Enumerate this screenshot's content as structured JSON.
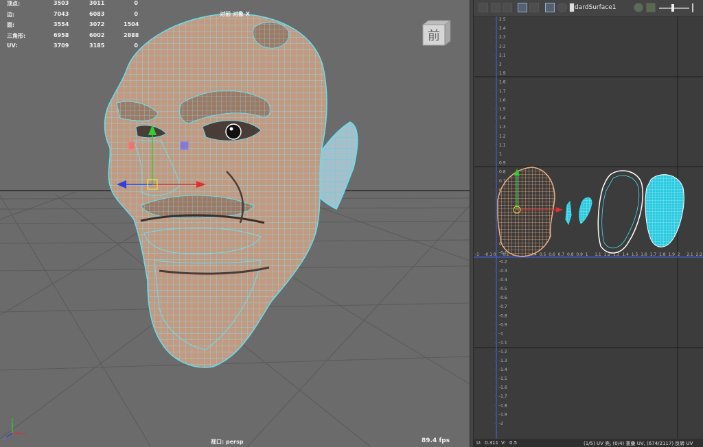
{
  "viewport": {
    "title": "对前 对象 X",
    "camera_label": "视口: persp",
    "fps": "89.4 fps",
    "view_cube_label": "前",
    "stats": [
      {
        "label": "顶点:",
        "a": "3503",
        "b": "3011",
        "c": "0"
      },
      {
        "label": "边:",
        "a": "7043",
        "b": "6083",
        "c": "0"
      },
      {
        "label": "面:",
        "a": "3554",
        "b": "3072",
        "c": "1504"
      },
      {
        "label": "三角形:",
        "a": "6958",
        "b": "6002",
        "c": "2888"
      },
      {
        "label": "UV:",
        "a": "3709",
        "b": "3185",
        "c": "0"
      }
    ],
    "axis_labels": {
      "x": "x",
      "y": "y",
      "z": "z"
    }
  },
  "uv_editor": {
    "surface_name": "dardSurface1",
    "toolbar_icons": [
      "uv-shell-icon",
      "texel-icon",
      "isolate-icon",
      "frame-icon",
      "grid-icon",
      "checker-icon",
      "wire-icon",
      "image-icon",
      "exposure-icon",
      "slider-icon"
    ],
    "ruler_ticks": [
      "2.5",
      "2.4",
      "2.3",
      "2.2",
      "2.1",
      "2",
      "1.9",
      "1.8",
      "1.7",
      "1.6",
      "1.5",
      "1.4",
      "1.3",
      "1.2",
      "1.1",
      "1",
      "0.9",
      "0.8",
      "0.7",
      "0.6",
      "0.5",
      "0.4",
      "0.3",
      "0.2",
      "0.1",
      "0",
      "-0.1",
      "-0.2",
      "-0.3",
      "-0.4",
      "-0.5",
      "-0.6",
      "-0.7",
      "-0.8",
      "-0.9",
      "-1",
      "-1.1",
      "-1.2",
      "-1.3",
      "-1.4",
      "-1.5",
      "-1.6",
      "-1.7",
      "-1.8",
      "-1.9",
      "-2"
    ],
    "h_ticks": [
      "-1",
      "-0.1",
      "0",
      "0.1",
      "0.2",
      "0.3",
      "0.4",
      "0.5",
      "0.6",
      "0.7",
      "0.8",
      "0.9",
      "1",
      "1.1",
      "1.2",
      "1.3",
      "1.4",
      "1.5",
      "1.6",
      "1.7",
      "1.8",
      "1.9",
      "2",
      "2.1",
      "2.2"
    ],
    "status": {
      "u": "U:",
      "u_val": "0.311",
      "v": "V:",
      "v_val": "0.5",
      "info": "(1/5) UV 壳, (0/4) 重叠 UV, (674/2117) 反转 UV"
    },
    "colors": {
      "selected_shell": "#f0b080",
      "cyan": "#40e0f0",
      "white": "#ffffff"
    }
  }
}
